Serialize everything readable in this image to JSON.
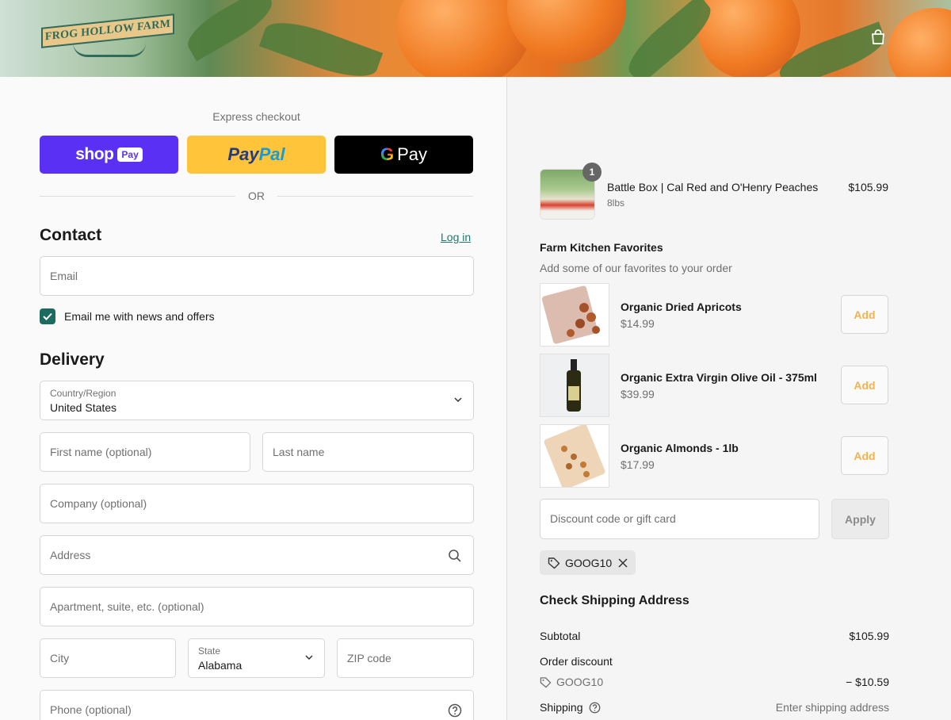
{
  "header": {
    "logo_text": "FROG HOLLOW FARM"
  },
  "express": {
    "label": "Express checkout",
    "shop_pay": {
      "shop": "shop",
      "pay": "Pay"
    },
    "paypal": {
      "pay": "Pay",
      "pal": "Pal"
    },
    "gpay": {
      "g": "G",
      "pay": "Pay"
    },
    "or": "OR"
  },
  "contact": {
    "title": "Contact",
    "login_link": "Log in",
    "email_placeholder": "Email",
    "newsletter_label": "Email me with news and offers",
    "newsletter_checked": true
  },
  "delivery": {
    "title": "Delivery",
    "country_label": "Country/Region",
    "country_value": "United States",
    "first_name_placeholder": "First name (optional)",
    "last_name_placeholder": "Last name",
    "company_placeholder": "Company (optional)",
    "address_placeholder": "Address",
    "apartment_placeholder": "Apartment, suite, etc. (optional)",
    "city_placeholder": "City",
    "state_label": "State",
    "state_value": "Alabama",
    "zip_placeholder": "ZIP code",
    "phone_placeholder": "Phone (optional)"
  },
  "cart": {
    "item": {
      "quantity": "1",
      "name": "Battle Box | Cal Red and O'Henry Peaches",
      "variant": "8lbs",
      "price": "$105.99"
    },
    "favorites_title": "Farm Kitchen Favorites",
    "favorites_subtitle": "Add some of our favorites to your order",
    "upsells": [
      {
        "name": "Organic Dried Apricots",
        "price": "$14.99",
        "add_label": "Add"
      },
      {
        "name": "Organic Extra Virgin Olive Oil - 375ml",
        "price": "$39.99",
        "add_label": "Add"
      },
      {
        "name": "Organic Almonds - 1lb",
        "price": "$17.99",
        "add_label": "Add"
      }
    ],
    "discount_placeholder": "Discount code or gift card",
    "apply_label": "Apply",
    "applied_code": "GOOG10",
    "shipping_title": "Check Shipping Address",
    "summary": {
      "subtotal_label": "Subtotal",
      "subtotal_value": "$105.99",
      "order_discount_label": "Order discount",
      "discount_code": "GOOG10",
      "discount_value": "− $10.59",
      "shipping_label": "Shipping",
      "shipping_value": "Enter shipping address"
    }
  },
  "colors": {
    "shop_pay": "#5a31f4",
    "paypal": "#ffc439",
    "gpay": "#000000",
    "accent_green": "#1d6b5f",
    "add_text": "#f5b24a"
  }
}
